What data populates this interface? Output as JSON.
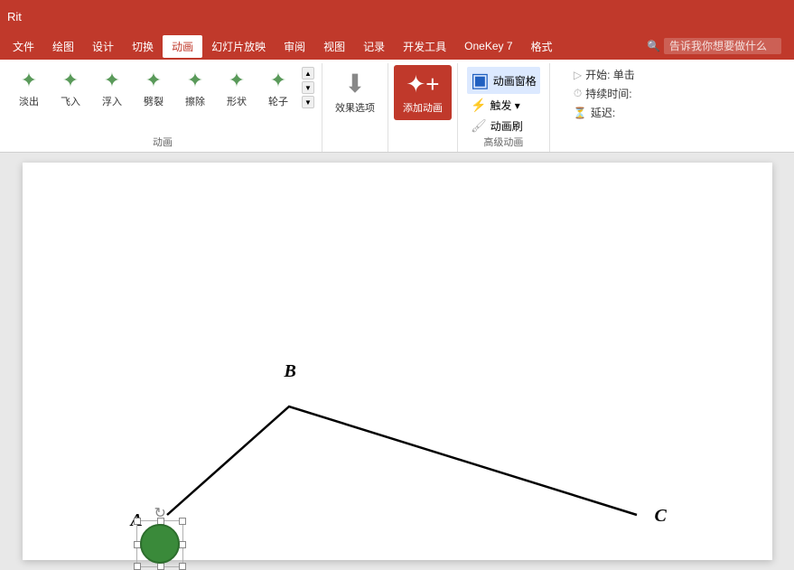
{
  "titleBar": {
    "text": "Rit"
  },
  "menuBar": {
    "items": [
      {
        "label": "文件",
        "active": false
      },
      {
        "label": "绘图",
        "active": false
      },
      {
        "label": "设计",
        "active": false
      },
      {
        "label": "切换",
        "active": false
      },
      {
        "label": "动画",
        "active": true
      },
      {
        "label": "幻灯片放映",
        "active": false
      },
      {
        "label": "审阅",
        "active": false
      },
      {
        "label": "视图",
        "active": false
      },
      {
        "label": "记录",
        "active": false
      },
      {
        "label": "开发工具",
        "active": false
      },
      {
        "label": "OneKey 7",
        "active": false
      },
      {
        "label": "格式",
        "active": false
      }
    ],
    "searchPlaceholder": "告诉我你想要做什么"
  },
  "ribbon": {
    "animationGroup": {
      "label": "动画",
      "items": [
        {
          "label": "淡出",
          "icon": "⭐"
        },
        {
          "label": "飞入",
          "icon": "⭐"
        },
        {
          "label": "浮入",
          "icon": "⭐"
        },
        {
          "label": "劈裂",
          "icon": "⭐"
        },
        {
          "label": "擦除",
          "icon": "⭐"
        },
        {
          "label": "形状",
          "icon": "⭐"
        },
        {
          "label": "轮子",
          "icon": "⭐"
        }
      ]
    },
    "effectGroup": {
      "label": "",
      "effectOptions": "效果选项"
    },
    "addAnimGroup": {
      "addAnim": "添加动画"
    },
    "advancedGroup": {
      "label": "高级动画",
      "items": [
        {
          "label": "动画窗格",
          "icon": "🎬",
          "active": true
        },
        {
          "label": "触发 ▾",
          "icon": "⚡"
        },
        {
          "label": "动画刷",
          "icon": "🖌"
        }
      ]
    },
    "timingGroup": {
      "label": "",
      "items": [
        {
          "label": "开始: 单击"
        },
        {
          "label": "持续时间:"
        },
        {
          "label": "延迟:"
        }
      ]
    }
  },
  "slide": {
    "labelA": "A",
    "labelB": "B",
    "labelC": "C"
  }
}
